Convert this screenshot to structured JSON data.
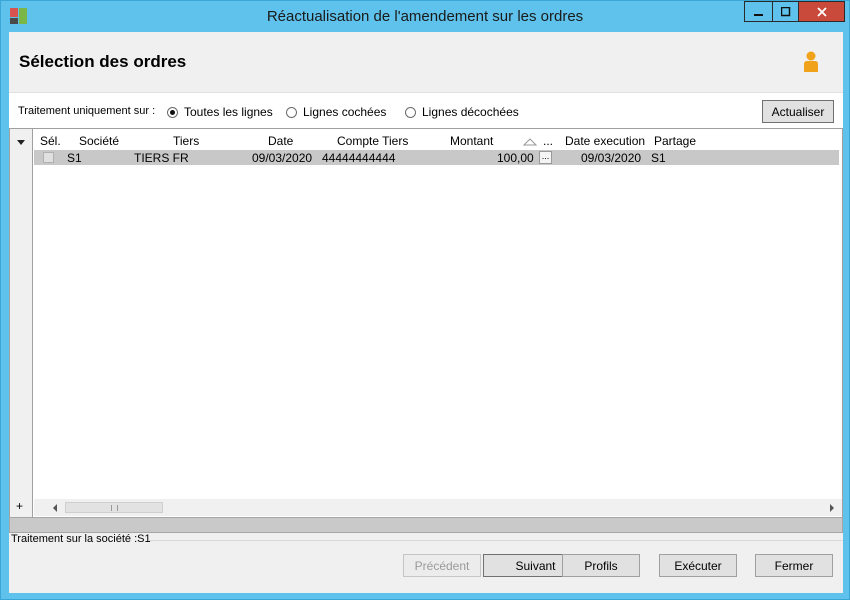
{
  "window": {
    "title": "Réactualisation de l'amendement sur les ordres",
    "controls": {
      "minimize": "minimize-icon",
      "maximize": "maximize-icon",
      "close": "close-icon"
    }
  },
  "header": {
    "title": "Sélection des ordres",
    "user_icon": "user-icon"
  },
  "filter": {
    "label": "Traitement uniquement sur :",
    "options": [
      {
        "label": "Toutes les lignes",
        "selected": true
      },
      {
        "label": "Lignes cochées",
        "selected": false
      },
      {
        "label": "Lignes décochées",
        "selected": false
      }
    ],
    "refresh_button": "Actualiser"
  },
  "grid": {
    "columns": [
      "Sél.",
      "Société",
      "Tiers",
      "Date",
      "Compte Tiers",
      "Montant",
      "...",
      "Date execution",
      "Partage"
    ],
    "rows": [
      {
        "selected": false,
        "societe": "S1",
        "tiers": "TIERS FR",
        "date": "09/03/2020",
        "compte_tiers": "44444444444",
        "montant": "100,00",
        "ellipsis": "...",
        "date_execution": "09/03/2020",
        "partage": "S1"
      }
    ],
    "add_row": "+"
  },
  "status": {
    "text": "Traitement sur la société :S1"
  },
  "footer": {
    "previous": "Précédent",
    "next": "Suivant",
    "profiles": "Profils",
    "execute": "Exécuter",
    "close": "Fermer"
  },
  "colors": {
    "titlebar": "#5ec2ec",
    "close_button": "#c9493a",
    "selected_row": "#c8c8c8",
    "user_icon": "#f0a31a"
  }
}
